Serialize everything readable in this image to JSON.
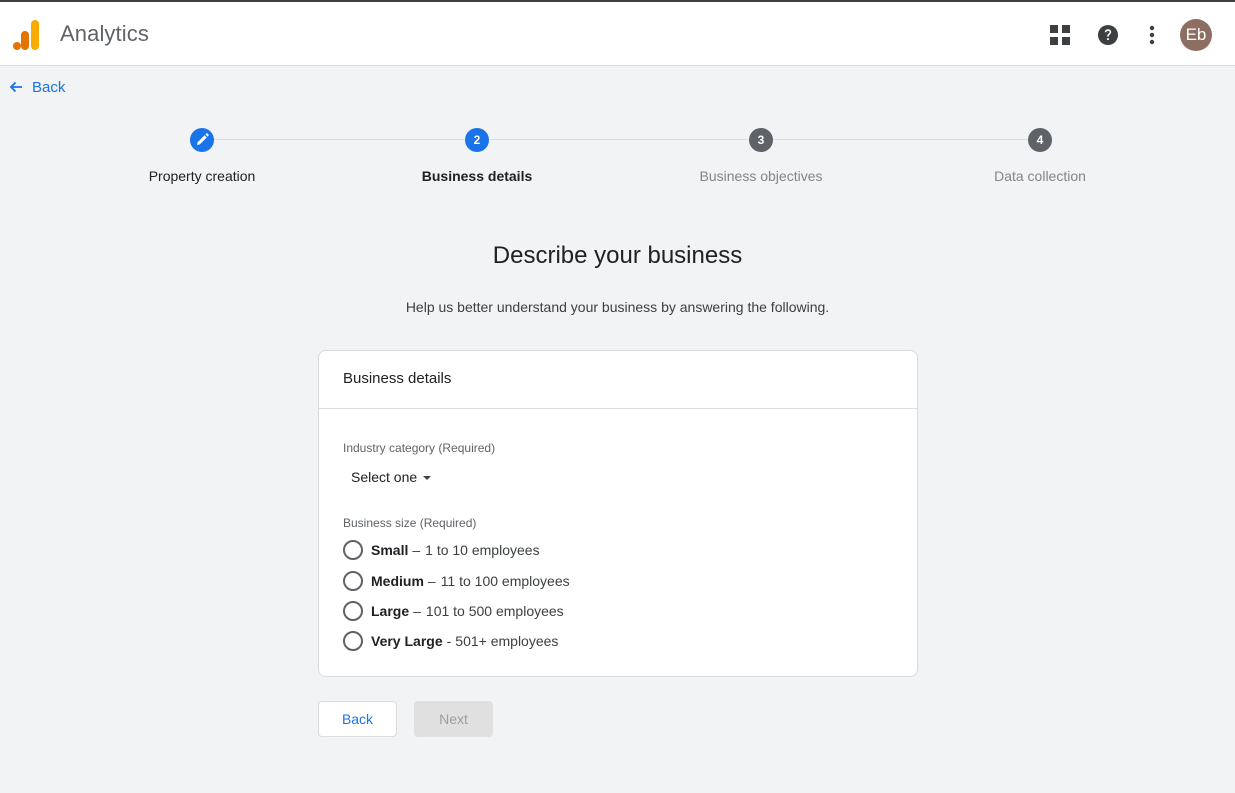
{
  "header": {
    "app_title": "Analytics",
    "avatar_initials": "Eb",
    "icons": [
      "apps-grid-icon",
      "help-icon",
      "more-vert-icon"
    ]
  },
  "nav": {
    "back_label": "Back"
  },
  "stepper": {
    "steps": [
      {
        "number": "",
        "label": "Property creation",
        "state": "completed"
      },
      {
        "number": "2",
        "label": "Business details",
        "state": "active"
      },
      {
        "number": "3",
        "label": "Business objectives",
        "state": "upcoming"
      },
      {
        "number": "4",
        "label": "Data collection",
        "state": "upcoming"
      }
    ]
  },
  "page": {
    "heading": "Describe your business",
    "subheading": "Help us better understand your business by answering the following."
  },
  "card": {
    "title": "Business details",
    "industry": {
      "label": "Industry category (Required)",
      "selected": "Select one"
    },
    "size": {
      "label": "Business size (Required)",
      "options": [
        {
          "name": "Small",
          "sep": "–",
          "detail": "1 to 10 employees",
          "selected": false
        },
        {
          "name": "Medium",
          "sep": "–",
          "detail": "11 to 100 employees",
          "selected": false
        },
        {
          "name": "Large",
          "sep": "–",
          "detail": "101 to 500 employees",
          "selected": false
        },
        {
          "name": "Very Large",
          "sep": "-",
          "detail": "501+ employees",
          "selected": false
        }
      ]
    }
  },
  "buttons": {
    "back": "Back",
    "next": "Next"
  },
  "colors": {
    "accent": "#1a73e8",
    "step_upcoming": "#5f6368",
    "logo_orange": "#f9ab00",
    "logo_dark_orange": "#e37400",
    "avatar_bg": "#8d6e63"
  }
}
